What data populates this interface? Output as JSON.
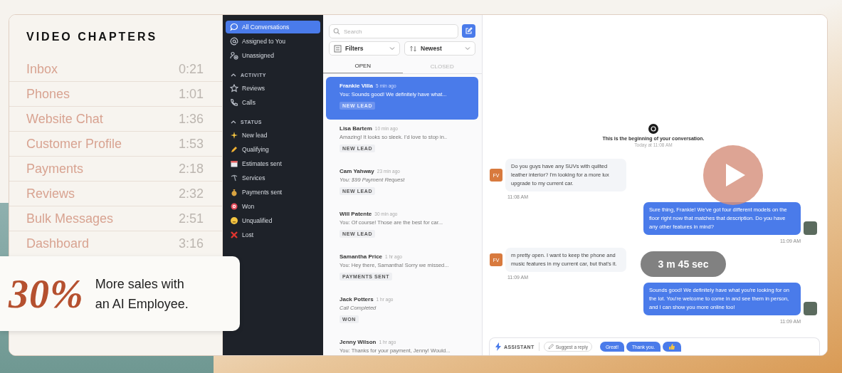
{
  "chapters_panel": {
    "title": "VIDEO CHAPTERS",
    "chapters": [
      {
        "label": "Inbox",
        "time": "0:21"
      },
      {
        "label": "Phones",
        "time": "1:01"
      },
      {
        "label": "Website Chat",
        "time": "1:36"
      },
      {
        "label": "Customer Profile",
        "time": "1:53"
      },
      {
        "label": "Payments",
        "time": "2:18"
      },
      {
        "label": "Reviews",
        "time": "2:32"
      },
      {
        "label": "Bulk Messages",
        "time": "2:51"
      },
      {
        "label": "Dashboard",
        "time": "3:16"
      }
    ]
  },
  "promo": {
    "stat": "30%",
    "text": "More sales with an AI Employee."
  },
  "video": {
    "duration": "3 m 45 sec",
    "sidebar": {
      "items": [
        {
          "label": "All Conversations",
          "selected": true
        },
        {
          "label": "Assigned to You",
          "selected": false
        },
        {
          "label": "Unassigned",
          "selected": false
        }
      ],
      "sections": [
        {
          "title": "ACTIVITY",
          "expanded": true,
          "items": [
            {
              "label": "Reviews",
              "selected": false
            },
            {
              "label": "Calls",
              "selected": false
            }
          ]
        },
        {
          "title": "STATUS",
          "expanded": true,
          "items": [
            {
              "label": "New lead",
              "selected": false
            },
            {
              "label": "Qualifying",
              "selected": false
            },
            {
              "label": "Estimates sent",
              "selected": false
            },
            {
              "label": "Services",
              "selected": false
            },
            {
              "label": "Payments sent",
              "selected": false
            },
            {
              "label": "Won",
              "selected": false
            },
            {
              "label": "Unqualified",
              "selected": false
            },
            {
              "label": "Lost",
              "selected": false
            }
          ]
        }
      ]
    },
    "list": {
      "search": {
        "placeholder": "Search"
      },
      "filter": "Filters",
      "sort": "Newest",
      "tabs": [
        {
          "label": "OPEN",
          "selected": true
        },
        {
          "label": "CLOSED",
          "selected": false
        }
      ],
      "conversations": [
        {
          "name": "Frankie Villa",
          "time": "5 min ago",
          "preview": "You: Sounds good! We definitely have what...",
          "italic": false,
          "tag": "NEW LEAD",
          "selected": true
        },
        {
          "name": "Lisa Bartem",
          "time": "10 min ago",
          "preview": "Amazing! It looks so sleek. I'd love to stop in..",
          "italic": false,
          "tag": "NEW LEAD",
          "selected": false
        },
        {
          "name": "Cam Yahway",
          "time": "23 min ago",
          "preview": "You: $99 Payment Request",
          "italic": true,
          "tag": "NEW LEAD",
          "selected": false
        },
        {
          "name": "Will Patente",
          "time": "30 min ago",
          "preview": "You: Of course! Those are the best for car...",
          "italic": false,
          "tag": "NEW LEAD",
          "selected": false
        },
        {
          "name": "Samantha Price",
          "time": "1 hr ago",
          "preview": "You: Hey there, Samantha! Sorry we missed...",
          "italic": false,
          "tag": "PAYMENTS SENT",
          "selected": false
        },
        {
          "name": "Jack Potters",
          "time": "1 hr ago",
          "preview": "Call Completed",
          "italic": true,
          "tag": "WON",
          "selected": false
        },
        {
          "name": "Jenny Wilson",
          "time": "1 hr ago",
          "preview": "You: Thanks for your payment, Jenny! Would...",
          "italic": false,
          "selected": false
        }
      ]
    },
    "chat": {
      "intro": "This is the beginning of your conversation.",
      "intro_time": "Today at 11:08 AM",
      "messages": [
        {
          "kind": "incoming",
          "avatar": "FV",
          "text": "Do you guys have any SUVs with quilted leather interior? I'm looking for a more lux upgrade to my current car.",
          "time": "11:08 AM"
        },
        {
          "kind": "outgoing",
          "text": "Sure thing, Frankie! We've got four different models on the floor right now that matches that description. Do you have any other features in mind?",
          "time": "11:09 AM"
        },
        {
          "kind": "incoming",
          "avatar": "FV",
          "text": "m pretty open. I want to keep the phone and music features in my current car, but that's it.",
          "time": "11:09 AM"
        },
        {
          "kind": "outgoing",
          "text": "Sounds good! We definitely have what you're looking for on the lot. You're welcome to come in and see them in person, and I can show you more online too!",
          "time": "11:09 AM"
        }
      ],
      "composer": {
        "assistant": "ASSISTANT",
        "suggest": "Suggest a reply",
        "quick_replies": [
          "Great!",
          "Thank you."
        ]
      }
    }
  }
}
